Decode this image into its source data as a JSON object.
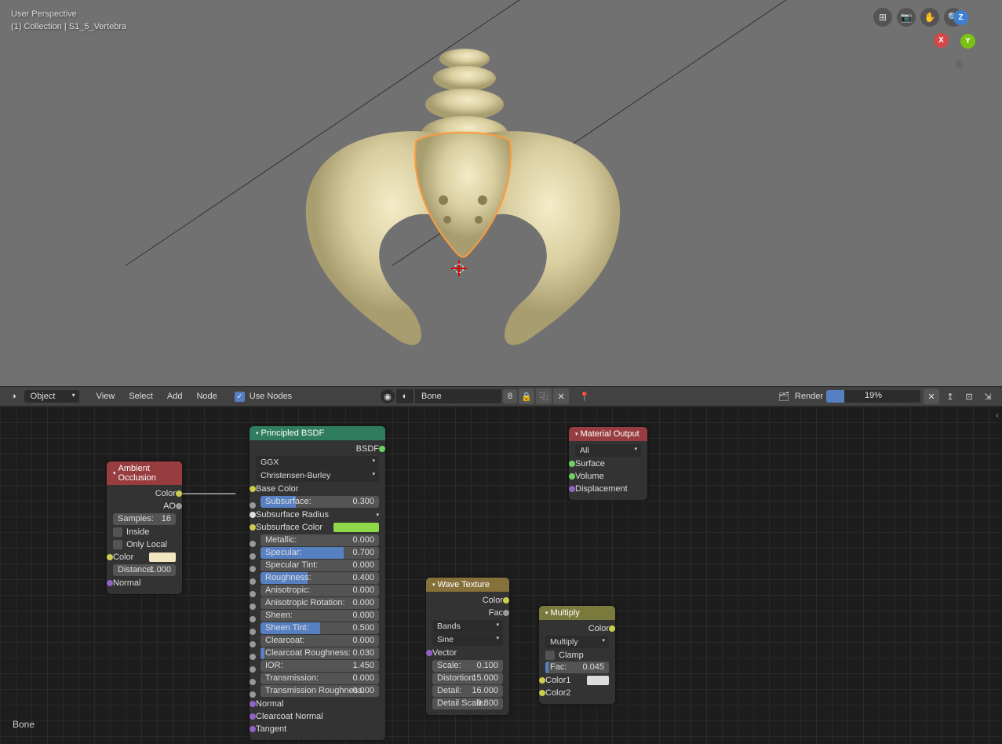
{
  "viewport": {
    "perspective": "User Perspective",
    "collection": "(1) Collection | S1_5_Vertebra"
  },
  "header": {
    "mode": "Object",
    "menus": [
      "View",
      "Select",
      "Add",
      "Node"
    ],
    "use_nodes": "Use Nodes",
    "material_name": "Bone",
    "users": "8",
    "render_label": "Render",
    "progress": "19%"
  },
  "nodes": {
    "ao": {
      "title": "Ambient Occlusion",
      "out_color": "Color",
      "out_ao": "AO",
      "samples_lbl": "Samples:",
      "samples_val": "16",
      "inside": "Inside",
      "only_local": "Only Local",
      "color_lbl": "Color",
      "color_val": "#f1e6bf",
      "distance_lbl": "Distance:",
      "distance_val": "1.000",
      "normal": "Normal"
    },
    "bsdf": {
      "title": "Principled BSDF",
      "out": "BSDF",
      "dist": "GGX",
      "sss": "Christensen-Burley",
      "base_color": "Base Color",
      "rows": [
        {
          "lbl": "Subsurface:",
          "val": "0.300",
          "fill": 30
        },
        {
          "lbl": "Subsurface Radius",
          "drop": true
        },
        {
          "lbl": "Subsurface Color",
          "color": "#8ed84a"
        },
        {
          "lbl": "Metallic:",
          "val": "0.000",
          "fill": 0
        },
        {
          "lbl": "Specular:",
          "val": "0.700",
          "fill": 70
        },
        {
          "lbl": "Specular Tint:",
          "val": "0.000",
          "fill": 0
        },
        {
          "lbl": "Roughness:",
          "val": "0.400",
          "fill": 40
        },
        {
          "lbl": "Anisotropic:",
          "val": "0.000",
          "fill": 0
        },
        {
          "lbl": "Anisotropic Rotation:",
          "val": "0.000",
          "fill": 0
        },
        {
          "lbl": "Sheen:",
          "val": "0.000",
          "fill": 0
        },
        {
          "lbl": "Sheen Tint:",
          "val": "0.500",
          "fill": 50
        },
        {
          "lbl": "Clearcoat:",
          "val": "0.000",
          "fill": 0
        },
        {
          "lbl": "Clearcoat Roughness:",
          "val": "0.030",
          "fill": 3
        },
        {
          "lbl": "IOR:",
          "val": "1.450",
          "num": true
        },
        {
          "lbl": "Transmission:",
          "val": "0.000",
          "fill": 0
        },
        {
          "lbl": "Transmission Roughness:",
          "val": "0.000",
          "fill": 0
        }
      ],
      "normal": "Normal",
      "clearnorm": "Clearcoat Normal",
      "tangent": "Tangent"
    },
    "output": {
      "title": "Material Output",
      "all": "All",
      "surface": "Surface",
      "volume": "Volume",
      "disp": "Displacement"
    },
    "wave": {
      "title": "Wave Texture",
      "out_color": "Color",
      "out_fac": "Fac",
      "type": "Bands",
      "profile": "Sine",
      "vector": "Vector",
      "scale_lbl": "Scale:",
      "scale_val": "0.100",
      "dist_lbl": "Distortion:",
      "dist_val": "15.000",
      "detail_lbl": "Detail:",
      "detail_val": "16.000",
      "dscale_lbl": "Detail Scale:",
      "dscale_val": "9.800"
    },
    "multiply": {
      "title": "Multiply",
      "out": "Color",
      "blend": "Multiply",
      "clamp": "Clamp",
      "fac_lbl": "Fac:",
      "fac_val": "0.045",
      "color1": "Color1",
      "color2": "Color2"
    }
  },
  "footer_material": "Bone"
}
